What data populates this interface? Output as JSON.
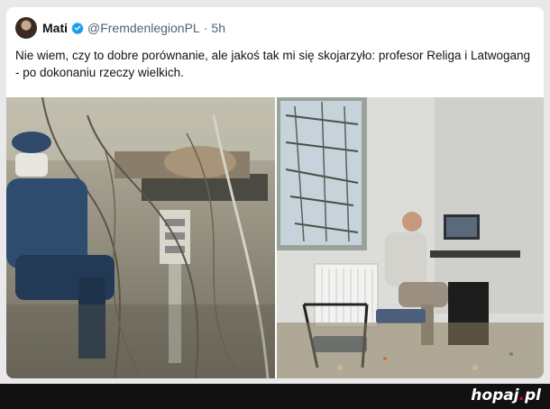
{
  "post": {
    "author_name": "Mati",
    "handle": "@FremdenlegionPL",
    "separator": "·",
    "time": "5h",
    "text": "Nie wiem, czy to dobre porównanie, ale jakoś tak mi się skojarzyło: profesor Religa i Latwogang - po dokonaniu rzeczy wielkich."
  },
  "icons": {
    "verified": "verified-badge-icon"
  },
  "colors": {
    "verified_blue": "#1d9bf0",
    "footer_bg": "#111111",
    "brand_red": "#e2001a"
  },
  "footer": {
    "brand_main": "hopaj",
    "brand_dot": ".",
    "brand_tld": "pl"
  }
}
